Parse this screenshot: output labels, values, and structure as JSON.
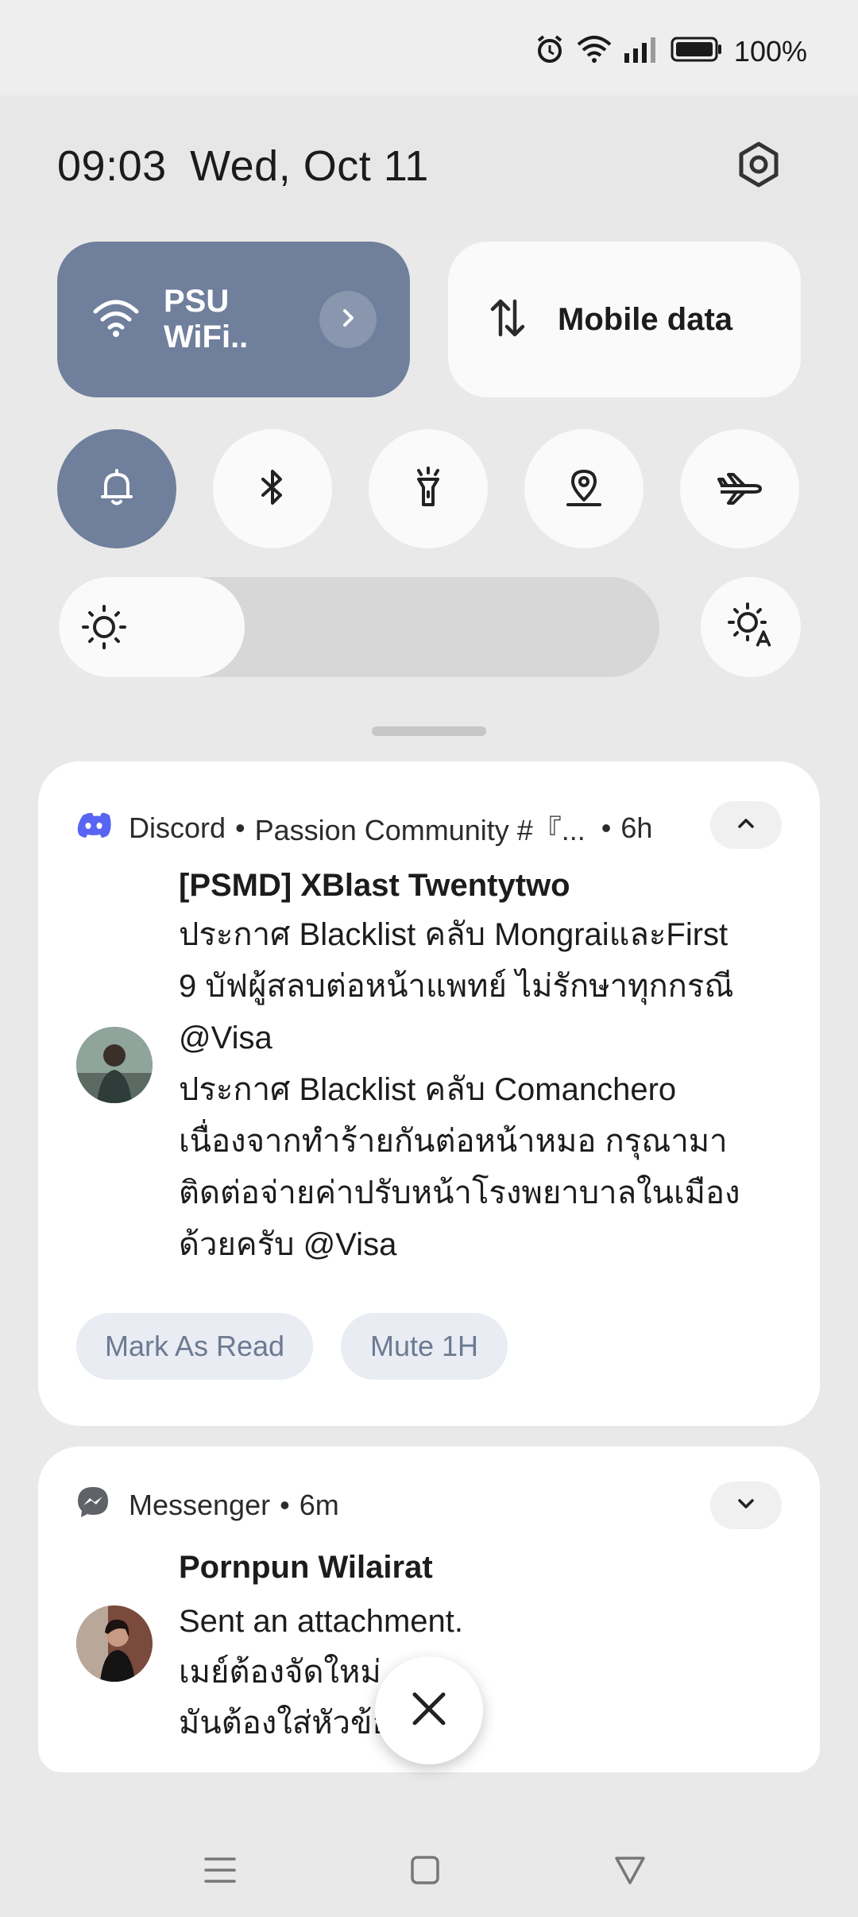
{
  "status_bar": {
    "battery_percent": "100%",
    "icons": [
      "alarm-icon",
      "wifi-icon",
      "signal-icon",
      "battery-icon"
    ]
  },
  "header": {
    "time": "09:03",
    "date": "Wed, Oct 11"
  },
  "quick_tiles": {
    "wifi": {
      "label": "PSU WiFi..",
      "active": true
    },
    "mobile_data": {
      "label": "Mobile data",
      "active": false
    },
    "round": [
      {
        "name": "sound",
        "icon": "bell-icon",
        "active": true
      },
      {
        "name": "bluetooth",
        "icon": "bluetooth-icon",
        "active": false
      },
      {
        "name": "flashlight",
        "icon": "flashlight-icon",
        "active": false
      },
      {
        "name": "location",
        "icon": "location-icon",
        "active": false
      },
      {
        "name": "airplane",
        "icon": "airplane-icon",
        "active": false
      }
    ],
    "brightness_level": 0.31
  },
  "notifications": {
    "discord": {
      "app": "Discord",
      "channel": "Passion Community #『...",
      "age": "6h",
      "title": "[PSMD] XBlast Twentytwo",
      "lines": [
        "ประกาศ Blacklist คลับ MongraiและFirst",
        "9 บัฟผู้สลบต่อหน้าแพทย์ ไม่รักษาทุกกรณี",
        "@Visa",
        "ประกาศ Blacklist คลับ Comanchero",
        "เนื่องจากทำร้ายกันต่อหน้าหมอ กรุณามา",
        "ติดต่อจ่ายค่าปรับหน้าโรงพยาบาลในเมือง",
        "ด้วยครับ @Visa"
      ],
      "actions": [
        "Mark As Read",
        "Mute 1H"
      ]
    },
    "messenger": {
      "app": "Messenger",
      "age": "6m",
      "title": "Pornpun Wilairat",
      "lines": [
        "Sent an attachment.",
        "เมย์ต้องจัดใหม่",
        "มันต้องใส่หัวข้อ"
      ]
    }
  },
  "colors": {
    "accent": "#6f7f9c",
    "discord_brand": "#5865f2",
    "chip_text": "#6c7a93"
  }
}
